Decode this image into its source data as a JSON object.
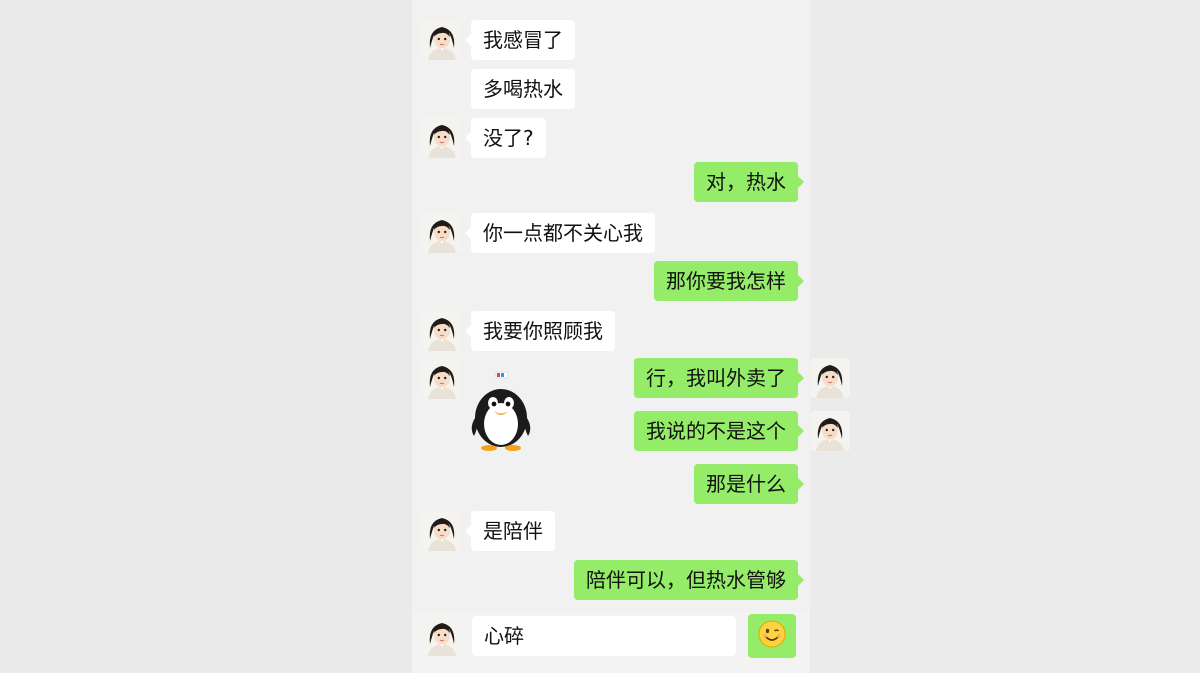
{
  "messages": [
    {
      "side": "in",
      "text": "我感冒了",
      "avatar": "avatar-girl"
    },
    {
      "side": "in",
      "text": "多喝热水"
    },
    {
      "side": "in",
      "text": "没了?",
      "avatar": "avatar-girl"
    },
    {
      "side": "out",
      "text": "对，热水"
    },
    {
      "side": "in",
      "text": "你一点都不关心我",
      "avatar": "avatar-girl"
    },
    {
      "side": "out",
      "text": "那你要我怎样"
    },
    {
      "side": "in",
      "text": "我要你照顾我",
      "avatar": "avatar-girl"
    },
    {
      "side": "in",
      "sticker": "penguin-sticker-icon",
      "avatar": "avatar-girl"
    },
    {
      "side": "out",
      "text": "行，我叫外卖了",
      "avatar": "avatar-girl"
    },
    {
      "side": "out",
      "text": "我说的不是这个",
      "avatar": "avatar-girl"
    },
    {
      "side": "out",
      "text": "那是什么"
    },
    {
      "side": "in",
      "text": "是陪伴",
      "avatar": "avatar-girl"
    },
    {
      "side": "out",
      "text": "陪伴可以，但热水管够"
    }
  ],
  "composer": {
    "avatar": "avatar-girl",
    "value": "心碎",
    "emoji_button_icon": "smiley-emoji-icon"
  },
  "colors": {
    "outgoing_bubble": "#95ec69",
    "incoming_bubble": "#ffffff",
    "chat_background": "#f1f1f1"
  }
}
